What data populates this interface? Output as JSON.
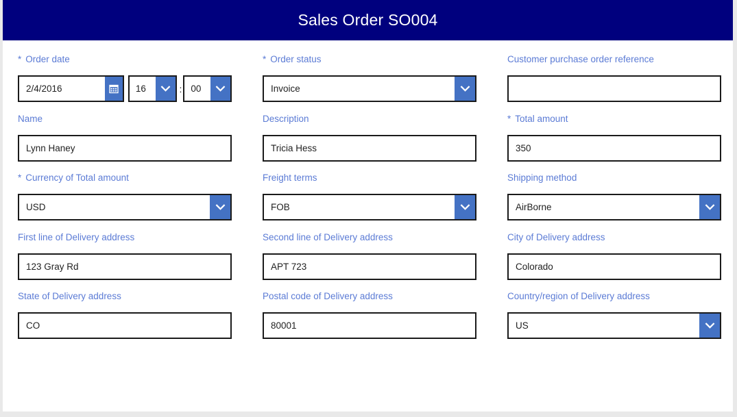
{
  "header": {
    "title": "Sales Order SO004",
    "background_color": "#00007E",
    "text_color": "#FFFFFF"
  },
  "theme": {
    "label_color": "#5B7BD5",
    "accent_button_color": "#4472C4",
    "field_border_color": "#1A1A1A",
    "page_background": "#E9E9E9",
    "card_background": "#FFFFFF"
  },
  "form": {
    "required_marker": "*",
    "time_separator": ":",
    "rows": [
      {
        "fields": [
          {
            "id": "order-date",
            "label": "Order date",
            "required": true,
            "type": "datetime",
            "date_value": "2/4/2016",
            "hour_value": "16",
            "minute_value": "00",
            "calendar_icon": "calendar-icon",
            "dropdown_icon": "chevron-down-icon"
          },
          {
            "id": "order-status",
            "label": "Order status",
            "required": true,
            "type": "combobox",
            "value": "Invoice",
            "dropdown_icon": "chevron-down-icon"
          },
          {
            "id": "customer-purchase-order-reference",
            "label": "Customer purchase order reference",
            "required": false,
            "type": "text",
            "value": "",
            "placeholder": ""
          }
        ]
      },
      {
        "fields": [
          {
            "id": "name",
            "label": "Name",
            "required": false,
            "type": "text",
            "value": "Lynn Haney",
            "placeholder": ""
          },
          {
            "id": "description",
            "label": "Description",
            "required": false,
            "type": "text",
            "value": "Tricia Hess",
            "placeholder": ""
          },
          {
            "id": "total-amount",
            "label": "Total amount",
            "required": true,
            "type": "text",
            "value": "350",
            "placeholder": ""
          }
        ]
      },
      {
        "fields": [
          {
            "id": "currency-of-total-amount",
            "label": "Currency of Total amount",
            "required": true,
            "type": "combobox",
            "value": "USD",
            "dropdown_icon": "chevron-down-icon"
          },
          {
            "id": "freight-terms",
            "label": "Freight terms",
            "required": false,
            "type": "combobox",
            "value": "FOB",
            "dropdown_icon": "chevron-down-icon"
          },
          {
            "id": "shipping-method",
            "label": "Shipping method",
            "required": false,
            "type": "combobox",
            "value": "AirBorne",
            "dropdown_icon": "chevron-down-icon"
          }
        ]
      },
      {
        "fields": [
          {
            "id": "first-line-of-delivery-address",
            "label": "First line of Delivery address",
            "required": false,
            "type": "text",
            "value": "123 Gray Rd",
            "placeholder": ""
          },
          {
            "id": "second-line-of-delivery-address",
            "label": "Second line of Delivery address",
            "required": false,
            "type": "text",
            "value": "APT 723",
            "placeholder": ""
          },
          {
            "id": "city-of-delivery-address",
            "label": "City of Delivery address",
            "required": false,
            "type": "text",
            "value": "Colorado",
            "placeholder": ""
          }
        ]
      },
      {
        "fields": [
          {
            "id": "state-of-delivery-address",
            "label": "State of Delivery address",
            "required": false,
            "type": "text",
            "value": "CO",
            "placeholder": ""
          },
          {
            "id": "postal-code-of-delivery-address",
            "label": "Postal code of Delivery address",
            "required": false,
            "type": "text",
            "value": "80001",
            "placeholder": ""
          },
          {
            "id": "country-region-of-delivery-address",
            "label": "Country/region of Delivery address",
            "required": false,
            "type": "combobox",
            "value": "US",
            "dropdown_icon": "chevron-down-icon"
          }
        ]
      }
    ]
  }
}
